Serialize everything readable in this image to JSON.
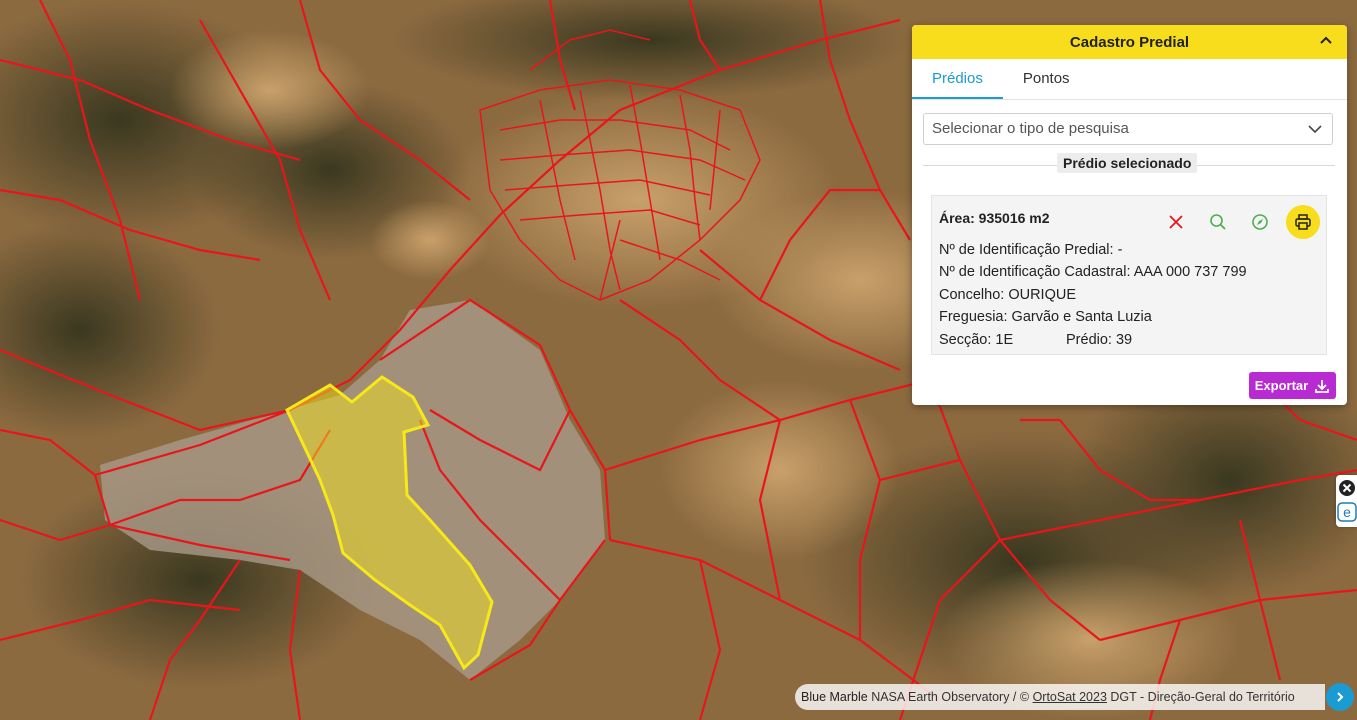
{
  "panel": {
    "title": "Cadastro Predial",
    "tabs": [
      {
        "label": "Prédios",
        "active": true
      },
      {
        "label": "Pontos",
        "active": false
      }
    ],
    "search_select": {
      "placeholder": "Selecionar o tipo de pesquisa"
    },
    "section_title": "Prédio selecionado",
    "selected": {
      "area": "Área: 935016 m2",
      "predial_id": "Nº de Identificação Predial: -",
      "cadastral_id": "Nº de Identificação Cadastral: AAA 000 737 799",
      "concelho": "Concelho: OURIQUE",
      "freguesia": "Freguesia: Garvão e Santa Luzia",
      "seccao": "Secção: 1E",
      "predio": "Prédio: 39"
    },
    "export_label": "Exportar"
  },
  "attribution": {
    "blue_marble": "Blue Marble",
    "nasa": "NASA Earth Observatory / ©",
    "ortosat": "OrtoSat 2023",
    "dgt": "DGT - Direção-Geral do Território"
  },
  "colors": {
    "header": "#f7dd1c",
    "tab_active": "#1a9bd1",
    "export": "#b82ad2",
    "parcel_border": "#e8161a",
    "selected_parcel": "#f2e21a"
  },
  "icons": [
    "chevron-up-icon",
    "chevron-down-icon",
    "close-icon",
    "search-icon",
    "compass-icon",
    "print-icon",
    "download-icon",
    "chevron-right-icon"
  ]
}
